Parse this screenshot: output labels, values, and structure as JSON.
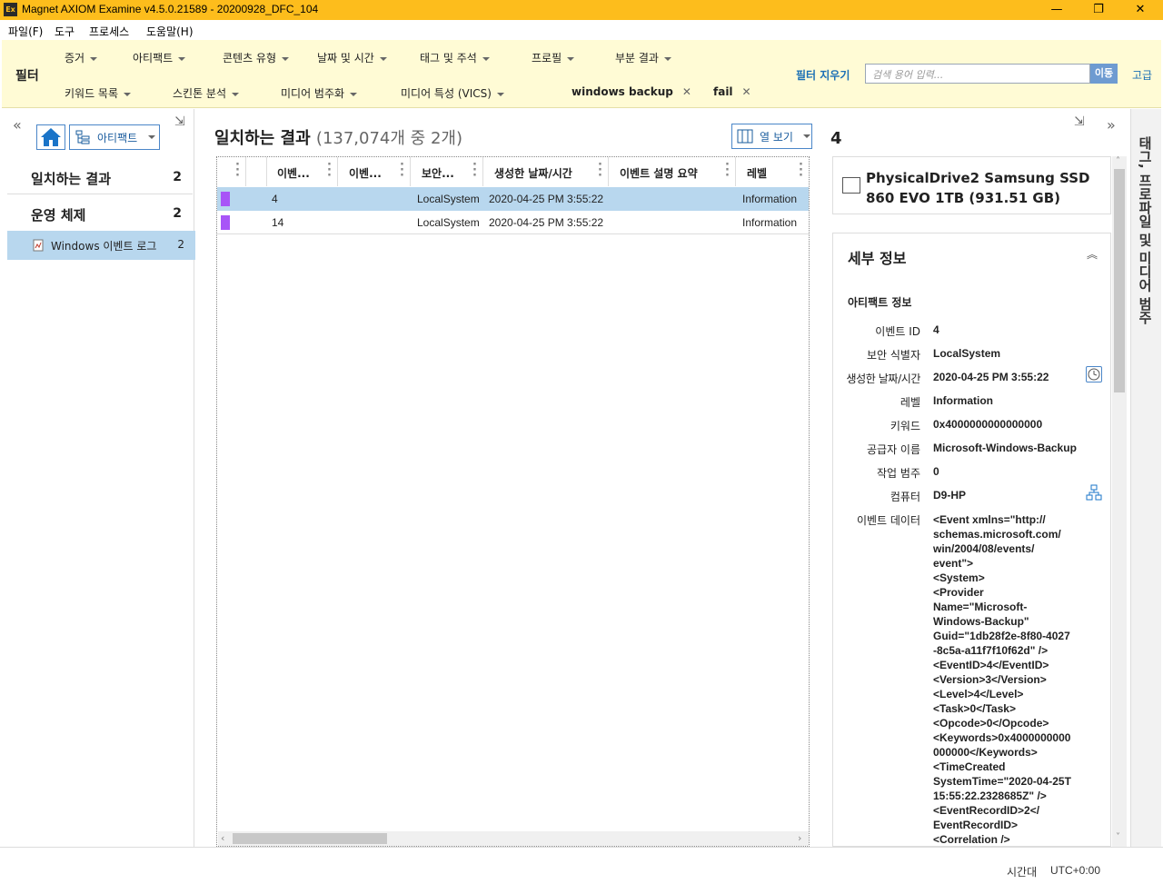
{
  "window": {
    "app_icon": "Ex",
    "title": "Magnet AXIOM Examine v4.5.0.21589 - 20200928_DFC_104",
    "minimize": "—",
    "maximize": "❐",
    "close": "✕"
  },
  "menu": {
    "file": "파일(F)",
    "tools": "도구",
    "process": "프로세스",
    "help": "도움말(H)"
  },
  "filters": {
    "label": "필터",
    "row1": [
      "증거",
      "아티팩트",
      "콘텐츠 유형",
      "날짜 및 시간",
      "태그 및 주석",
      "프로필",
      "부분 결과"
    ],
    "row2": [
      "키워드 목록",
      "스킨톤 분석",
      "미디어 범주화",
      "미디어 특성 (VICS)"
    ],
    "tags": [
      "windows backup",
      "fail"
    ],
    "clear": "필터 지우기",
    "search_placeholder": "검색 용어 입력...",
    "go": "이동",
    "advanced": "고급"
  },
  "left": {
    "collapse": "«",
    "pin": "⇲",
    "artifact_selector": "아티팩트",
    "nav": [
      {
        "label": "일치하는 결과",
        "count": "2"
      },
      {
        "label": "운영 체제",
        "count": "2"
      },
      {
        "label": "Windows 이벤트 로그",
        "count": "2"
      }
    ]
  },
  "center": {
    "title": "일치하는 결과",
    "subtitle": "(137,074개 중 2개)",
    "column_view": "열 보기",
    "columns": [
      "이벤...",
      "이벤...",
      "보안...",
      "생성한 날짜/시간",
      "이벤트 설명 요약",
      "레벨"
    ],
    "rows": [
      {
        "event_id": "4",
        "security": "LocalSystem",
        "created": "2020-04-25 PM 3:55:22",
        "level": "Information",
        "color": "#a855f7"
      },
      {
        "event_id": "14",
        "security": "LocalSystem",
        "created": "2020-04-25 PM 3:55:22",
        "level": "Information",
        "color": "#a855f7"
      }
    ]
  },
  "right": {
    "count": "4",
    "pin": "⇲",
    "expand": "»",
    "source": "PhysicalDrive2 Samsung SSD 860 EVO 1TB (931.51 GB)",
    "details_title": "세부 정보",
    "section": "아티팩트 정보",
    "fields": [
      {
        "key": "이벤트 ID",
        "value": "4"
      },
      {
        "key": "보안 식별자",
        "value": "LocalSystem"
      },
      {
        "key": "생성한 날짜/시간",
        "value": "2020-04-25 PM 3:55:22"
      },
      {
        "key": "레벨",
        "value": "Information"
      },
      {
        "key": "키워드",
        "value": "0x4000000000000000"
      },
      {
        "key": "공급자 이름",
        "value": "Microsoft-Windows-Backup"
      },
      {
        "key": "작업 범주",
        "value": "0"
      },
      {
        "key": "컴퓨터",
        "value": "D9-HP"
      }
    ],
    "event_data_key": "이벤트 데이터",
    "event_data": "<Event xmlns=\"http://\nschemas.microsoft.com/\nwin/2004/08/events/\nevent\">\n<System>\n<Provider\nName=\"Microsoft-\nWindows-Backup\"\nGuid=\"1db28f2e-8f80-4027\n-8c5a-a11f7f10f62d\" />\n<EventID>4</EventID>\n<Version>3</Version>\n<Level>4</Level>\n<Task>0</Task>\n<Opcode>0</Opcode>\n<Keywords>0x4000000000\n000000</Keywords>\n<TimeCreated\nSystemTime=\"2020-04-25T\n15:55:22.2328685Z\" />\n<EventRecordID>2</\nEventRecordID>\n<Correlation />"
  },
  "side_tab": "태그, 프로파일 및 미디어 범주",
  "status": {
    "tz_label": "시간대",
    "tz_value": "UTC+0:00"
  }
}
